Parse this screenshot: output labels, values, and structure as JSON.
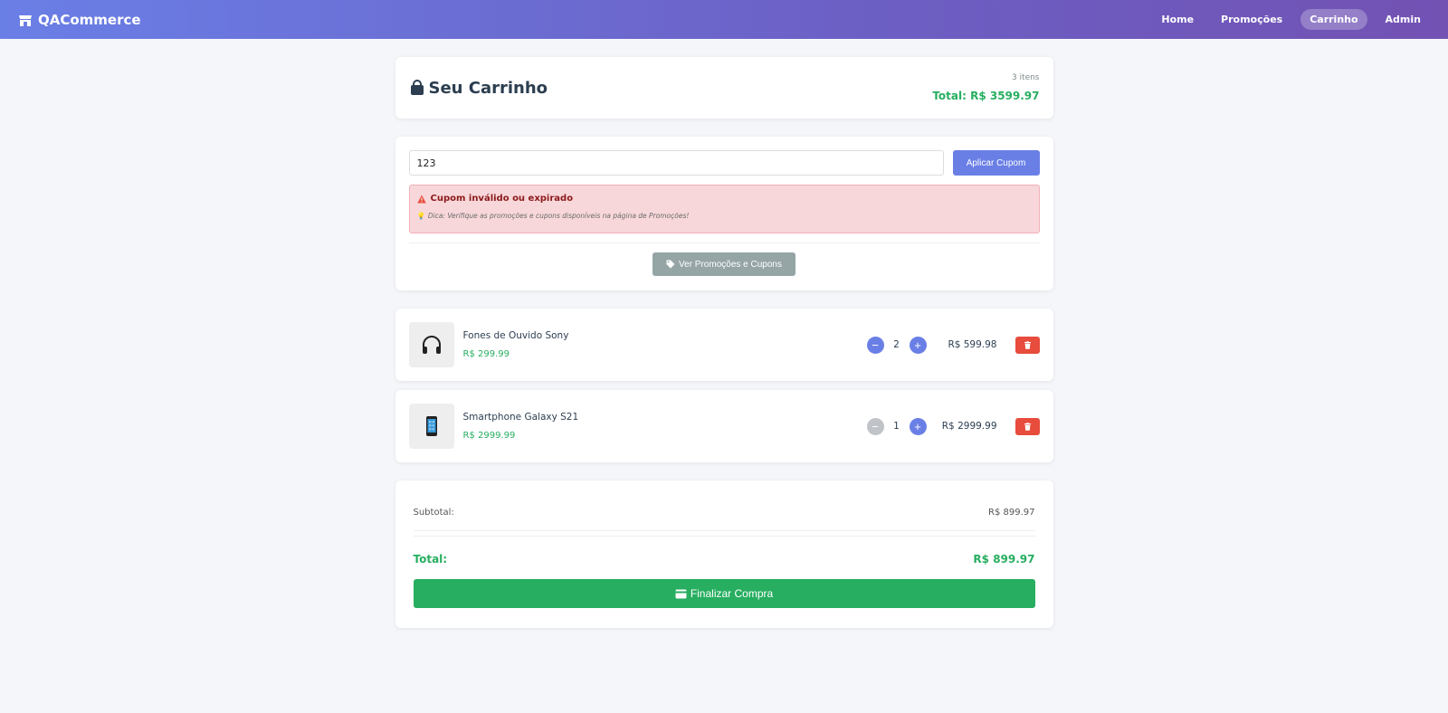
{
  "navbar": {
    "brand": "QACommerce",
    "links": [
      "Home",
      "Promoções",
      "Carrinho",
      "Admin"
    ],
    "active": "Carrinho"
  },
  "cart_header": {
    "title": "Seu Carrinho",
    "item_count": "3 itens",
    "total": "Total: R$ 3599.97"
  },
  "coupon": {
    "input_value": "123",
    "apply_label": "Aplicar Cupom",
    "error_title": "Cupom inválido ou expirado",
    "error_hint": "Dica: Verifique as promoções e cupons disponíveis na página de Promoções!",
    "promo_button": "Ver Promoções e Cupons"
  },
  "items": [
    {
      "name": "Fones de Ouvido Sony",
      "price": "R$ 299.99",
      "quantity": "2",
      "subtotal": "R$ 599.98",
      "icon": "headphones-icon",
      "minus_enabled": true
    },
    {
      "name": "Smartphone Galaxy S21",
      "price": "R$ 2999.99",
      "quantity": "1",
      "subtotal": "R$ 2999.99",
      "icon": "smartphone-icon",
      "minus_enabled": false
    }
  ],
  "summary": {
    "subtotal_label": "Subtotal:",
    "subtotal_value": "R$ 899.97",
    "total_label": "Total:",
    "total_value": "R$ 899.97",
    "checkout_label": "Finalizar Compra"
  },
  "colors": {
    "accent": "#6a7fe6",
    "success": "#27ae60",
    "danger": "#e74c3c",
    "secondary": "#95a5a6"
  }
}
